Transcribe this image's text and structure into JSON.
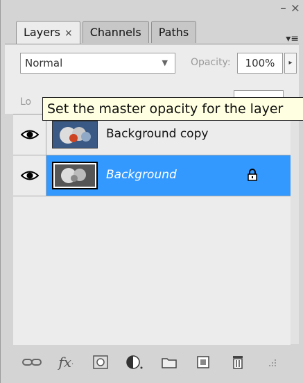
{
  "window": {
    "minimize_glyph": "–",
    "close_glyph": "×"
  },
  "tabs": [
    {
      "label": "Layers",
      "close_glyph": "×",
      "active": true
    },
    {
      "label": "Channels",
      "active": false
    },
    {
      "label": "Paths",
      "active": false
    }
  ],
  "panel_menu_glyph": "▾≡",
  "blend_mode": {
    "value": "Normal",
    "arrow": "▼"
  },
  "opacity": {
    "label": "Opacity:",
    "value": "100%",
    "stepper": "▸"
  },
  "lock": {
    "label": "Lo"
  },
  "tooltip": {
    "text": "Set the master opacity for the layer"
  },
  "layers": [
    {
      "name": "Background copy",
      "selected": false,
      "locked": false,
      "visible": true
    },
    {
      "name": "Background",
      "selected": true,
      "locked": true,
      "visible": true
    }
  ],
  "scroll": {
    "up": "▲",
    "down": "▼"
  },
  "toolbar": [
    "link-layers-icon",
    "layer-style-fx-icon",
    "layer-mask-icon",
    "adjustment-layer-icon",
    "new-group-folder-icon",
    "new-layer-icon",
    "delete-layer-trash-icon"
  ],
  "colors": {
    "selection": "#3399ff",
    "panel": "#d4d4d4",
    "content": "#ececec",
    "tooltip": "#ffffe1"
  }
}
